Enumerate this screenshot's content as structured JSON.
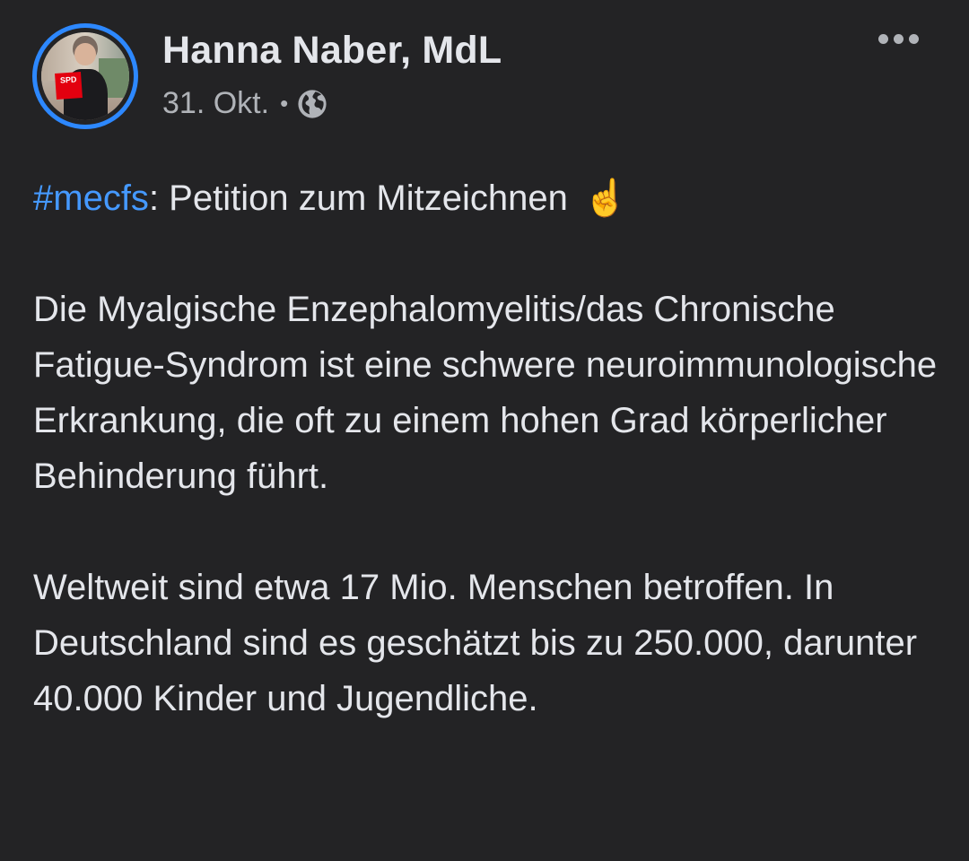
{
  "post": {
    "author": "Hanna Naber, MdL",
    "date": "31. Okt.",
    "separator": "•",
    "audience_icon": "globe-icon",
    "avatar_sign_text": "SPD",
    "hashtag": "#mecfs",
    "headline_rest": ": Petition zum Mitzeichnen",
    "headline_emoji": "☝️",
    "paragraphs": [
      "Die Myalgische Enzephalomyelitis/das Chronische Fatigue-Syndrom ist eine schwere neuroimmunologische Erkrankung, die oft zu einem hohen Grad körperlicher Behinderung führt.",
      "Weltweit sind etwa 17 Mio. Menschen betroffen. In Deutschland sind es geschätzt bis zu 250.000, darunter 40.000 Kinder und Jugendliche."
    ]
  },
  "colors": {
    "background": "#232325",
    "text": "#e4e6eb",
    "secondary_text": "#b0b3b8",
    "hashtag": "#4599ff",
    "story_ring": "#2d88ff"
  },
  "icons": {
    "more_options": "more-options-icon",
    "audience": "globe-icon"
  }
}
